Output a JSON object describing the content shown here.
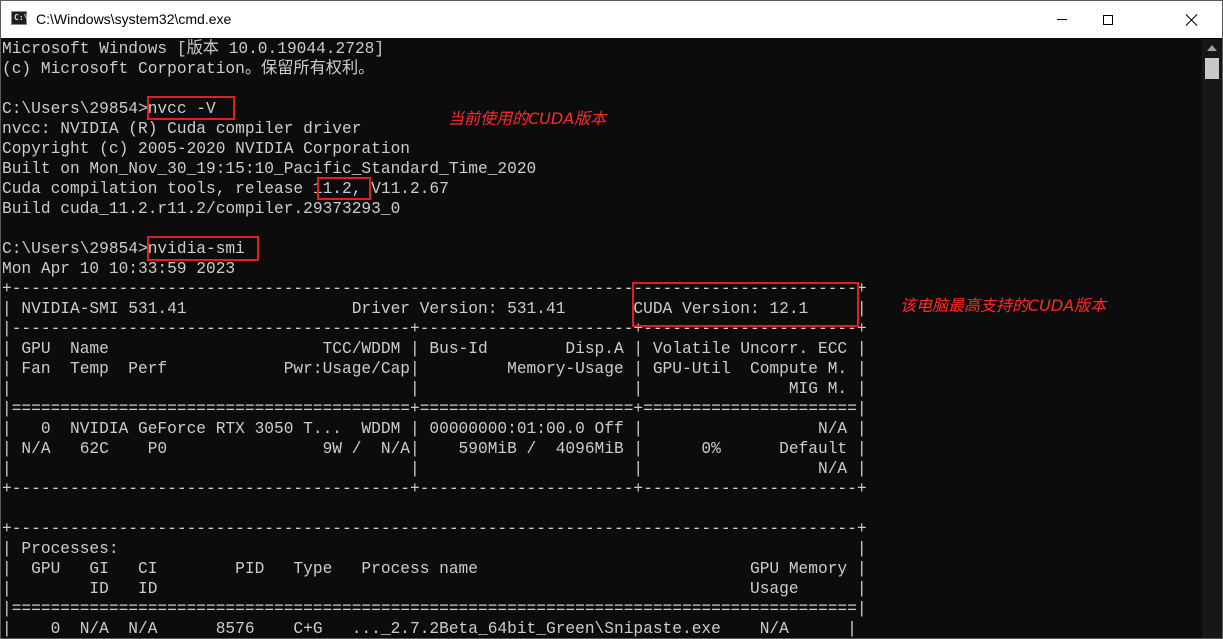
{
  "window": {
    "title": "C:\\Windows\\system32\\cmd.exe",
    "icon_label": "C:\\"
  },
  "console": {
    "lines": [
      "Microsoft Windows [版本 10.0.19044.2728]",
      "(c) Microsoft Corporation。保留所有权利。",
      "",
      "C:\\Users\\29854>nvcc -V",
      "nvcc: NVIDIA (R) Cuda compiler driver",
      "Copyright (c) 2005-2020 NVIDIA Corporation",
      "Built on Mon_Nov_30_19:15:10_Pacific_Standard_Time_2020",
      "Cuda compilation tools, release 11.2, V11.2.67",
      "Build cuda_11.2.r11.2/compiler.29373293_0",
      "",
      "C:\\Users\\29854>nvidia-smi",
      "Mon Apr 10 10:33:59 2023",
      "+---------------------------------------------------------------------------------------+",
      "| NVIDIA-SMI 531.41                 Driver Version: 531.41       CUDA Version: 12.1     |",
      "|-----------------------------------------+----------------------+----------------------+",
      "| GPU  Name                      TCC/WDDM | Bus-Id        Disp.A | Volatile Uncorr. ECC |",
      "| Fan  Temp  Perf            Pwr:Usage/Cap|         Memory-Usage | GPU-Util  Compute M. |",
      "|                                         |                      |               MIG M. |",
      "|=========================================+======================+======================|",
      "|   0  NVIDIA GeForce RTX 3050 T...  WDDM | 00000000:01:00.0 Off |                  N/A |",
      "| N/A   62C    P0                9W /  N/A|    590MiB /  4096MiB |      0%      Default |",
      "|                                         |                      |                  N/A |",
      "+-----------------------------------------+----------------------+----------------------+",
      "",
      "+---------------------------------------------------------------------------------------+",
      "| Processes:                                                                            |",
      "|  GPU   GI   CI        PID   Type   Process name                            GPU Memory |",
      "|        ID   ID                                                             Usage      |",
      "|=======================================================================================|",
      "|    0  N/A  N/A      8576    C+G   ..._2.7.2Beta_64bit_Green\\Snipaste.exe    N/A      |"
    ]
  },
  "annotations": {
    "current_cuda": "当前使用的CUDA版本",
    "max_supported_cuda": "该电脑最高支持的CUDA版本"
  }
}
